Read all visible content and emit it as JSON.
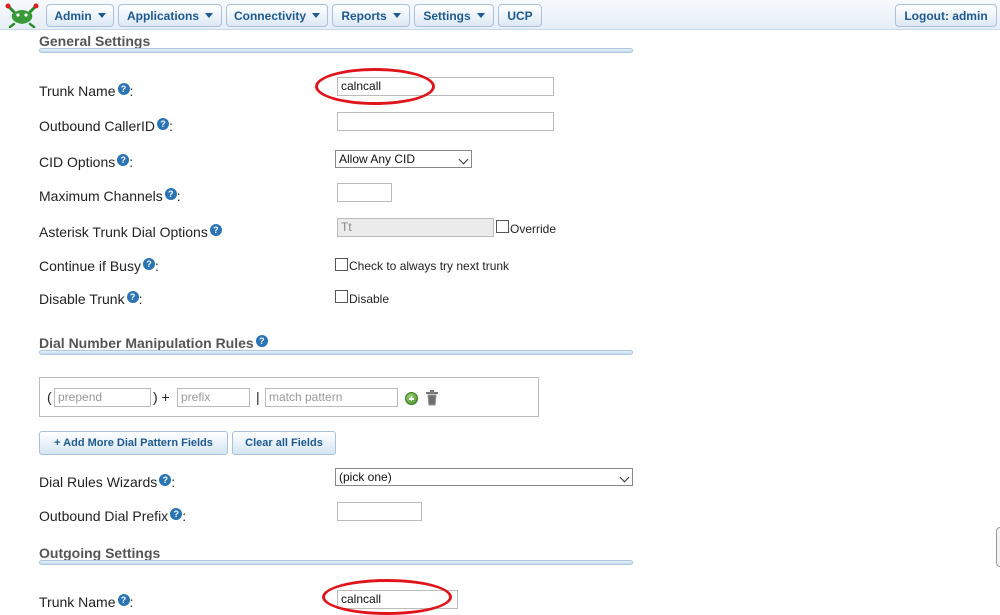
{
  "nav": {
    "admin": "Admin",
    "applications": "Applications",
    "connectivity": "Connectivity",
    "reports": "Reports",
    "settings": "Settings",
    "ucp": "UCP",
    "logout": "Logout: admin"
  },
  "general": {
    "title": "General Settings",
    "trunk_name_label": "Trunk Name",
    "trunk_name_value": "calncall",
    "outbound_callerid_label": "Outbound CallerID",
    "outbound_callerid_value": "",
    "cid_options_label": "CID Options",
    "cid_options_value": "Allow Any CID",
    "max_channels_label": "Maximum Channels",
    "max_channels_value": "",
    "dial_options_label": "Asterisk Trunk Dial Options",
    "dial_options_value": "Tt",
    "override_label": "Override",
    "continue_busy_label": "Continue if Busy",
    "continue_busy_check_label": "Check to always try next trunk",
    "disable_trunk_label": "Disable Trunk",
    "disable_check_label": "Disable"
  },
  "dial_rules": {
    "title": "Dial Number Manipulation Rules",
    "open_paren": "(",
    "close_paren_plus": ") +",
    "pipe": "|",
    "prepend_placeholder": "prepend",
    "prefix_placeholder": "prefix",
    "match_placeholder": "match pattern",
    "add_more_label": "+ Add More Dial Pattern Fields",
    "clear_all_label": "Clear all Fields",
    "wizards_label": "Dial Rules Wizards",
    "wizards_value": "(pick one)",
    "outbound_prefix_label": "Outbound Dial Prefix",
    "outbound_prefix_value": ""
  },
  "outgoing": {
    "title": "Outgoing Settings",
    "trunk_name_label": "Trunk Name",
    "trunk_name_value": "calncall"
  },
  "help_glyph": "?",
  "colon": ":",
  "colors": {
    "annotation": "#e0141b",
    "nav_text": "#1e5a8f",
    "help_icon": "#2a74b4"
  }
}
